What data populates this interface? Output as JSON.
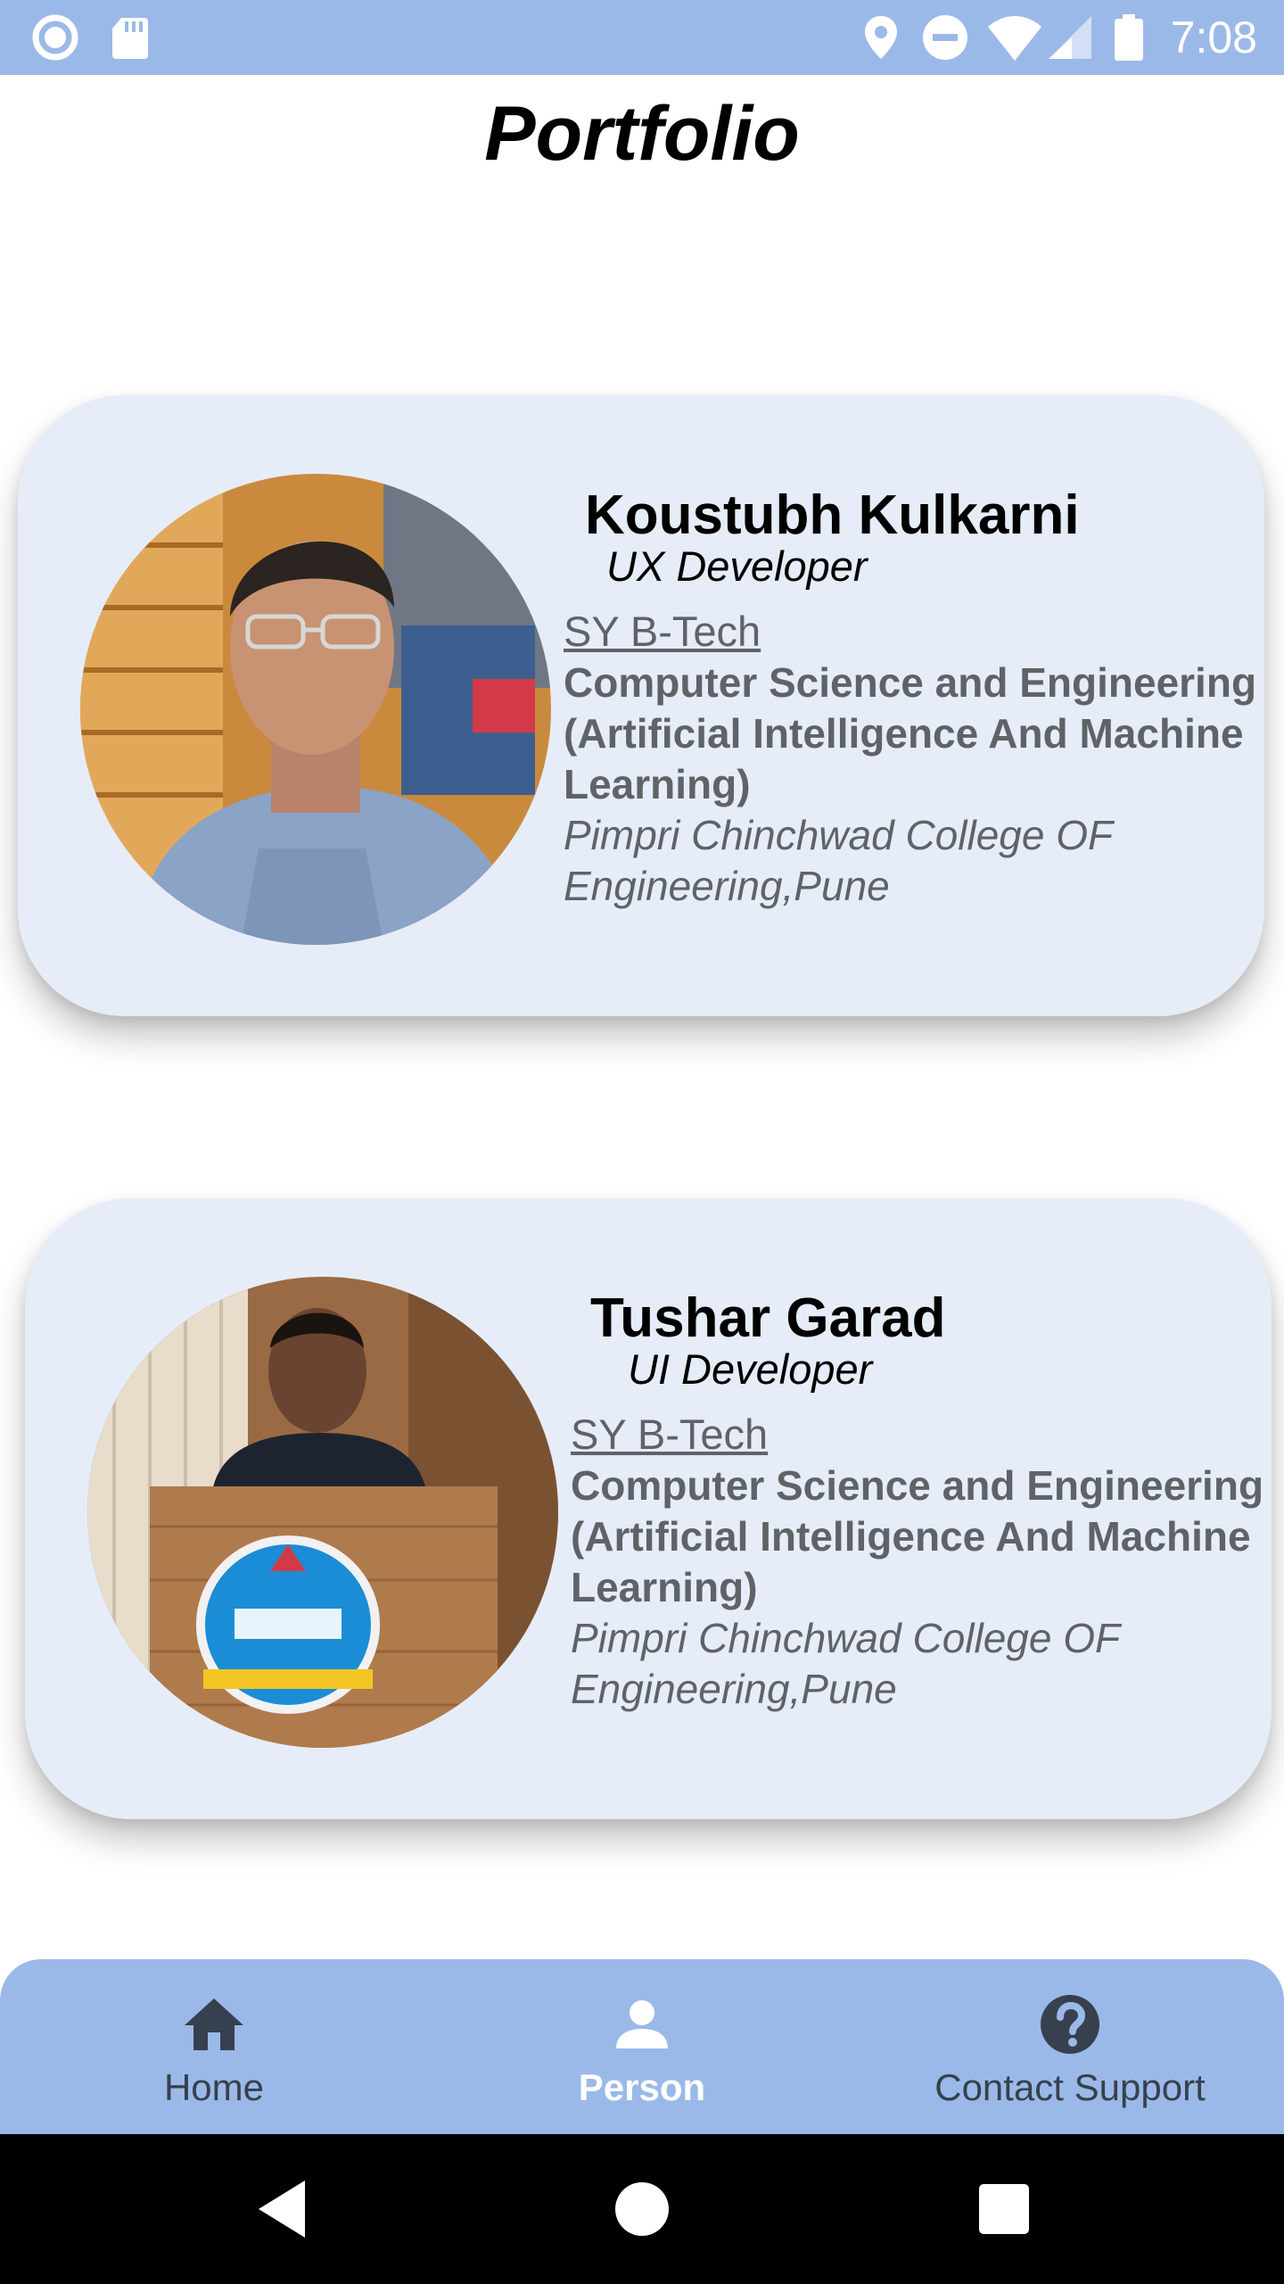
{
  "status_bar": {
    "time": "7:08",
    "left_icons": [
      "record-icon",
      "sd-card-icon"
    ],
    "right_icons": [
      "location-icon",
      "do-not-disturb-icon",
      "wifi-icon",
      "signal-icon",
      "battery-icon"
    ],
    "background": "#9bb9e8"
  },
  "page": {
    "title": "Portfolio"
  },
  "profiles": [
    {
      "name": "Koustubh Kulkarni",
      "role": "UX Developer",
      "year": "SY B-Tech",
      "branch": "Computer Science and Engineering (Artificial Intelligence And Machine Learning)",
      "college": "Pimpri Chinchwad College OF Engineering,Pune"
    },
    {
      "name": "Tushar Garad",
      "role": "UI Developer",
      "year": "SY B-Tech",
      "branch": "Computer Science and Engineering (Artificial Intelligence And Machine Learning)",
      "college": "Pimpri Chinchwad College OF Engineering,Pune"
    }
  ],
  "bottom_nav": {
    "items": [
      {
        "label": "Home",
        "icon": "home-icon",
        "active": false
      },
      {
        "label": "Person",
        "icon": "person-icon",
        "active": true
      },
      {
        "label": "Contact Support",
        "icon": "help-icon",
        "active": false
      }
    ]
  },
  "colors": {
    "card_background": "#e6edf8",
    "nav_background": "#9bb9e8",
    "active_label": "#ffffff",
    "secondary_text": "#5f6368"
  }
}
